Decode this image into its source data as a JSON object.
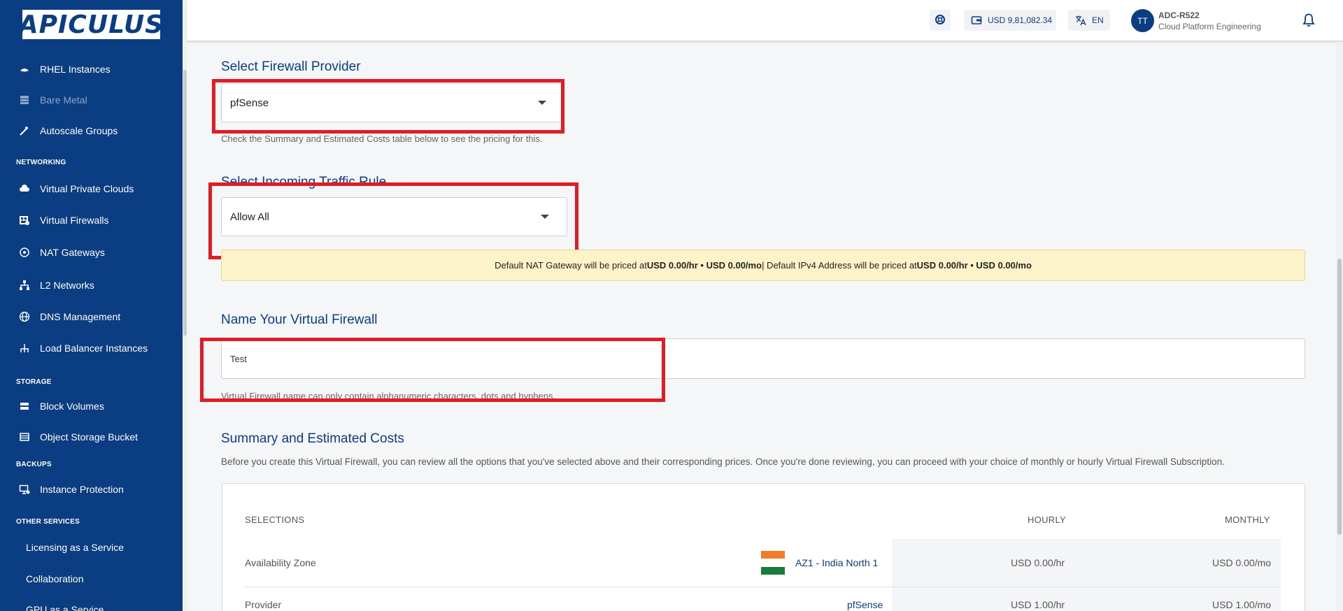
{
  "sidebar": {
    "logo": "APICULUS",
    "items": [
      {
        "label": "RHEL Instances",
        "icon": "hat-icon"
      },
      {
        "label": "Bare Metal",
        "icon": "server-icon",
        "disabled": true
      },
      {
        "label": "Autoscale Groups",
        "icon": "magic-wand-icon"
      },
      {
        "label": "Virtual Private Clouds",
        "icon": "cloud-icon"
      },
      {
        "label": "Virtual Firewalls",
        "icon": "firewall-icon"
      },
      {
        "label": "NAT Gateways",
        "icon": "network-icon"
      },
      {
        "label": "L2 Networks",
        "icon": "hierarchy-icon"
      },
      {
        "label": "DNS Management",
        "icon": "globe-icon"
      },
      {
        "label": "Load Balancer Instances",
        "icon": "load-balancer-icon"
      },
      {
        "label": "Block Volumes",
        "icon": "volume-icon"
      },
      {
        "label": "Object Storage Bucket",
        "icon": "bucket-icon"
      },
      {
        "label": "Instance Protection",
        "icon": "monitor-icon"
      },
      {
        "label": "Licensing as a Service"
      },
      {
        "label": "Collaboration"
      },
      {
        "label": "GPU as a Service"
      }
    ],
    "sections": [
      "NETWORKING",
      "STORAGE",
      "BACKUPS",
      "OTHER SERVICES"
    ]
  },
  "topbar": {
    "balance": "USD 9,81,082.34",
    "language": "EN",
    "avatar_initials": "TT",
    "user_name": "ADC-R522",
    "user_org": "Cloud Platform Engineering"
  },
  "provider": {
    "title": "Select Firewall Provider",
    "value": "pfSense",
    "help": "Check the Summary and Estimated Costs table below to see the pricing for this."
  },
  "traffic": {
    "title": "Select Incoming Traffic Rule",
    "value": "Allow All"
  },
  "notice": {
    "part1": "Default NAT Gateway will be priced at ",
    "price1": "USD 0.00/hr • USD 0.00/mo",
    "part2": " | Default IPv4 Address will be priced at ",
    "price2": "USD 0.00/hr • USD 0.00/mo"
  },
  "name": {
    "title": "Name Your Virtual Firewall",
    "value": "Test",
    "help": "Virtual Firewall name can only contain alphanumeric characters, dots and hyphens."
  },
  "summary": {
    "title": "Summary and Estimated Costs",
    "description": "Before you create this Virtual Firewall, you can review all the options that you've selected above and their corresponding prices. Once you're done reviewing, you can proceed with your choice of monthly or hourly Virtual Firewall Subscription.",
    "headers": {
      "selections": "SELECTIONS",
      "hourly": "HOURLY",
      "monthly": "MONTHLY"
    },
    "rows": [
      {
        "label": "Availability Zone",
        "value": "AZ1 - India North 1",
        "hourly": "USD 0.00/hr",
        "monthly": "USD 0.00/mo"
      },
      {
        "label": "Provider",
        "value": "pfSense",
        "hourly": "USD 1.00/hr",
        "monthly": "USD 1.00/mo"
      }
    ]
  },
  "colors": {
    "brand": "#0a3d82",
    "highlight": "#e01d24",
    "notice_bg": "#fdf3c8"
  }
}
